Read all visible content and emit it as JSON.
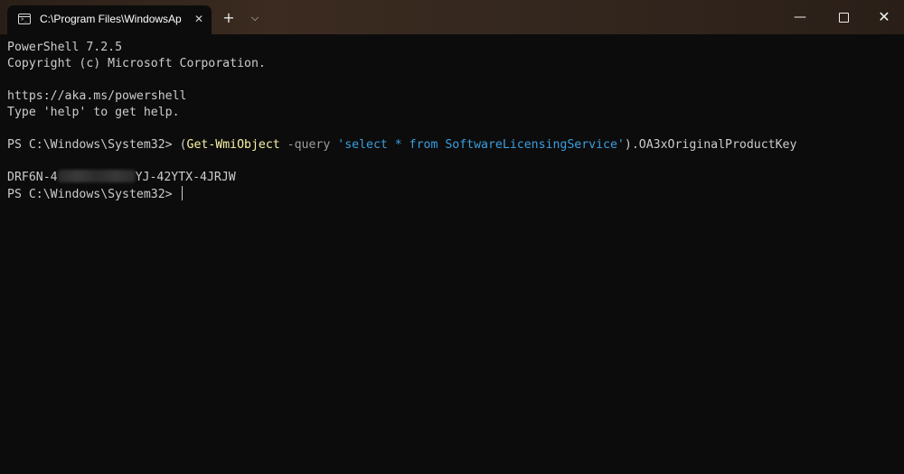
{
  "titlebar": {
    "tab_title": "C:\\Program Files\\WindowsAp",
    "tab_icon": "terminal-icon",
    "close_glyph": "✕",
    "new_tab_glyph": "+",
    "dropdown_glyph": "⌵",
    "minimize_glyph": "—",
    "close_window_glyph": "✕"
  },
  "terminal": {
    "line1": "PowerShell 7.2.5",
    "line2": "Copyright (c) Microsoft Corporation.",
    "line3": "https://aka.ms/powershell",
    "line4": "Type 'help' to get help.",
    "prompt": "PS C:\\Windows\\System32> ",
    "command": {
      "open_paren": "(",
      "cmdlet": "Get-WmiObject",
      "param": " -query ",
      "string": "'select * from SoftwareLicensingService'",
      "close_paren": ")",
      "property": ".OA3xOriginalProductKey"
    },
    "output_prefix": "DRF6N-4",
    "output_suffix": "YJ-42YTX-4JRJW",
    "final_prompt": "PS C:\\Windows\\System32> "
  },
  "colors": {
    "background": "#0c0c0c",
    "foreground": "#cccccc",
    "cmdlet": "#f9f1a5",
    "parameter": "#9e9e9e",
    "string": "#3b9ee0"
  }
}
